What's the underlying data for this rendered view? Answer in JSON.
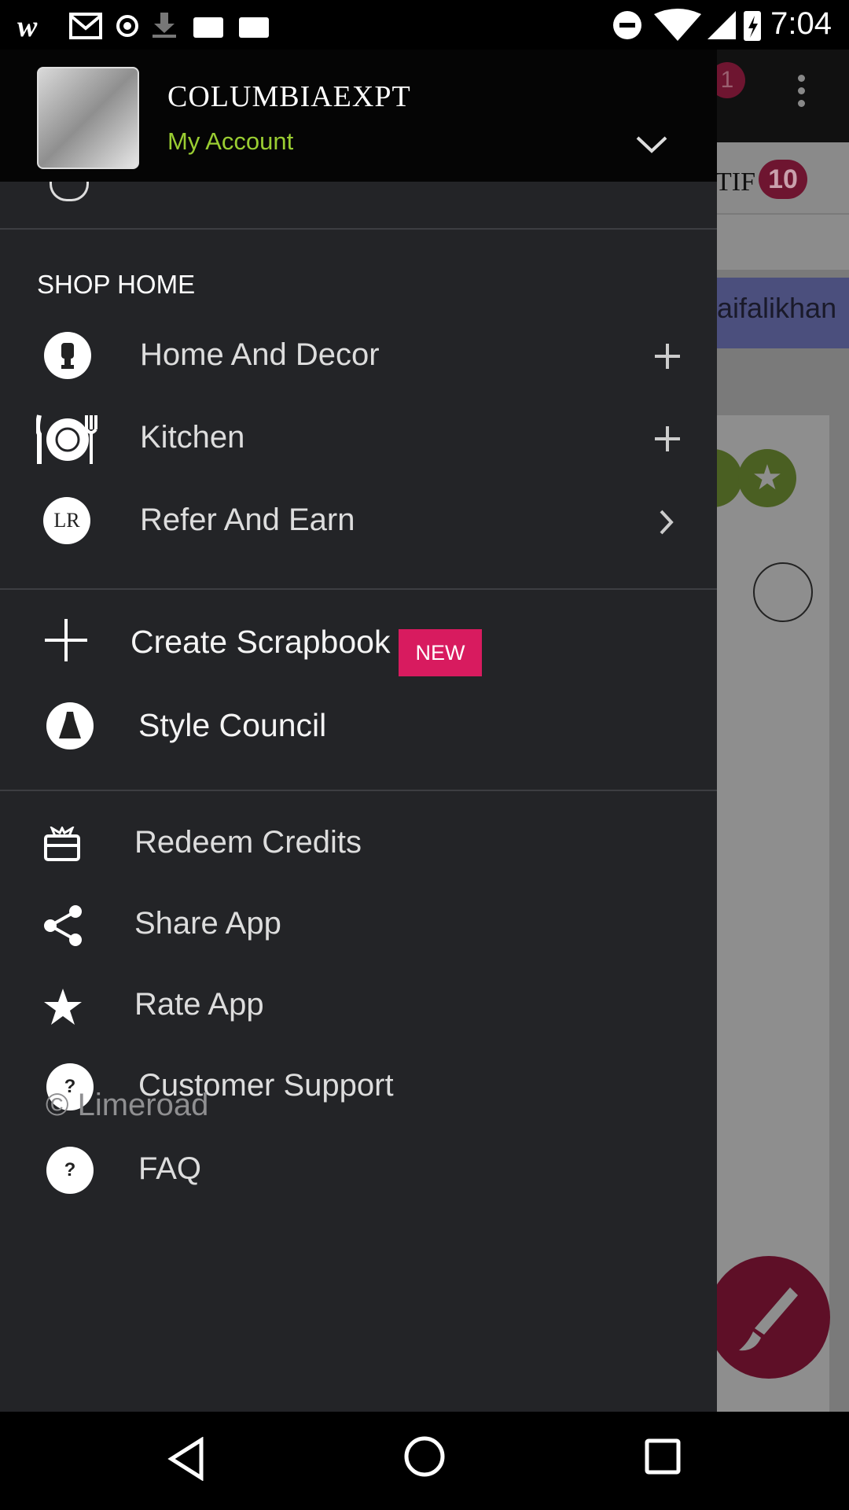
{
  "status_bar": {
    "time": "7:04"
  },
  "drawer": {
    "header": {
      "username": "COLUMBIAEXPT",
      "account_label": "My Account"
    },
    "section_title": "SHOP HOME",
    "shop_items": [
      {
        "label": "Home And Decor",
        "icon": "lamp-icon",
        "action": "expand"
      },
      {
        "label": "Kitchen",
        "icon": "plate-fork-knife-icon",
        "action": "expand"
      },
      {
        "label": "Refer And Earn",
        "icon": "lr-logo-icon",
        "action": "navigate"
      }
    ],
    "create_scrapbook": {
      "label": "Create Scrapbook",
      "badge": "NEW"
    },
    "style_council": {
      "label": "Style Council"
    },
    "menu_items": [
      {
        "label": "Redeem Credits",
        "icon": "gift-card-icon"
      },
      {
        "label": "Share App",
        "icon": "share-icon"
      },
      {
        "label": "Rate App",
        "icon": "star-icon"
      },
      {
        "label": "Customer Support",
        "icon": "help-icon"
      },
      {
        "label": "FAQ",
        "icon": "help-icon"
      }
    ],
    "footer": "© Limeroad"
  },
  "background_app": {
    "cart_badge": "1",
    "tab_text": "TIF",
    "tab_badge": "10",
    "banner_text": "aifalikhan"
  },
  "colors": {
    "accent": "#d81b5f",
    "account_green": "#9acd32",
    "drawer_bg": "#232427"
  }
}
